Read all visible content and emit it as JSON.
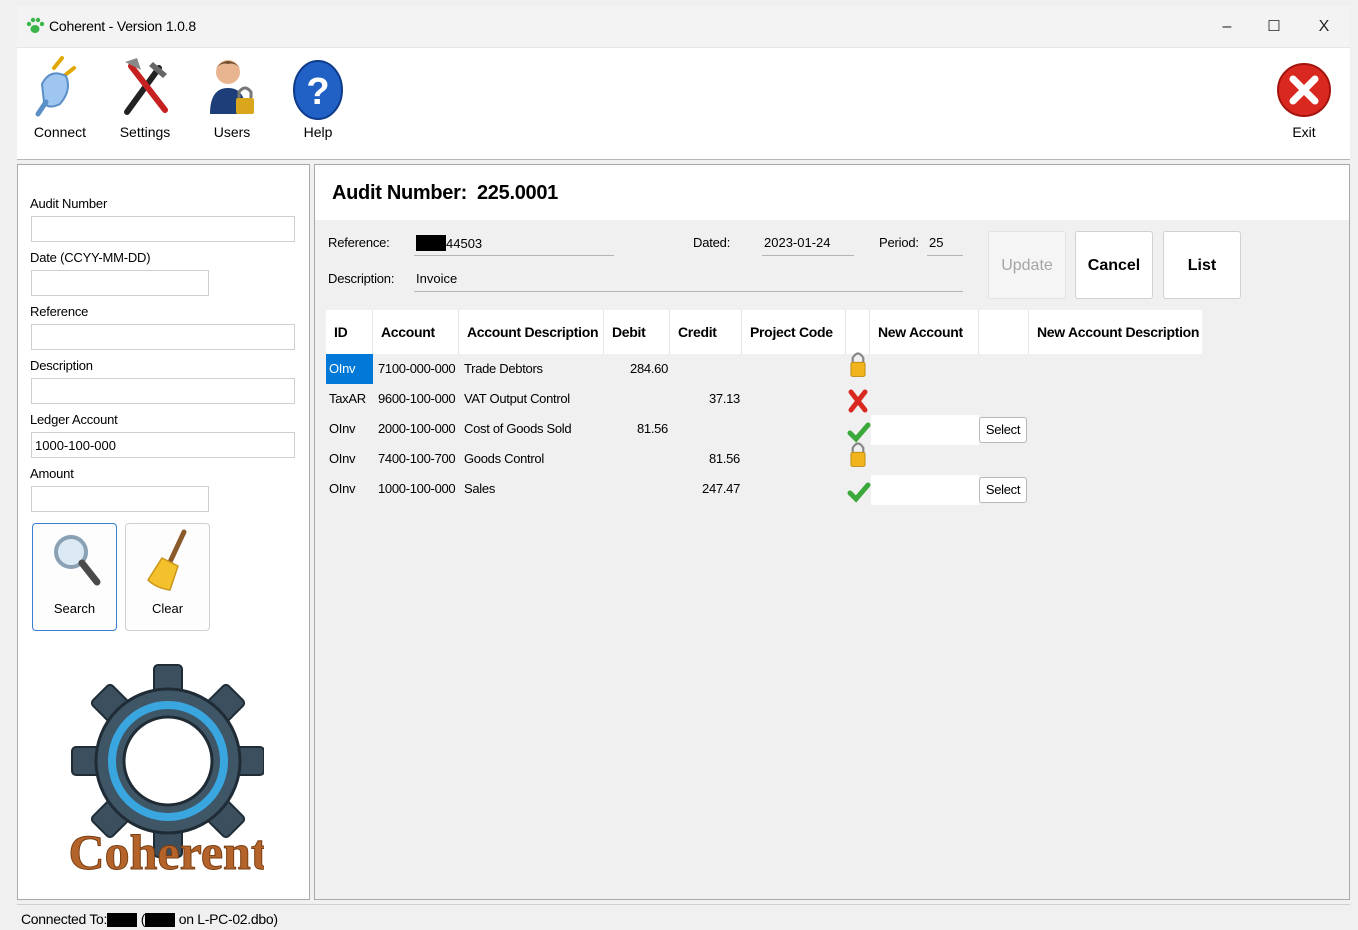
{
  "window": {
    "title": "Coherent - Version 1.0.8",
    "minimize": "–",
    "maximize": "☐",
    "close": "X"
  },
  "toolbar": {
    "items": [
      {
        "label": "Connect",
        "icon": "plug-icon"
      },
      {
        "label": "Settings",
        "icon": "tools-icon"
      },
      {
        "label": "Users",
        "icon": "user-lock-icon"
      },
      {
        "label": "Help",
        "icon": "help-icon"
      }
    ],
    "exit_label": "Exit"
  },
  "search_panel": {
    "audit_number_label": "Audit Number",
    "audit_number_value": "",
    "date_label": "Date (CCYY-MM-DD)",
    "date_value": "",
    "reference_label": "Reference",
    "reference_value": "",
    "description_label": "Description",
    "description_value": "",
    "ledger_account_label": "Ledger Account",
    "ledger_account_value": "1000-100-000",
    "amount_label": "Amount",
    "amount_value": "",
    "search_label": "Search",
    "clear_label": "Clear",
    "logo_text": "Coherent"
  },
  "audit": {
    "heading_label": "Audit Number:",
    "heading_value": "225.0001",
    "reference_label": "Reference:",
    "reference_value": "44503",
    "dated_label": "Dated:",
    "dated_value": "2023-01-24",
    "period_label": "Period:",
    "period_value": "25",
    "description_label": "Description:",
    "description_value": "Invoice",
    "update_label": "Update",
    "cancel_label": "Cancel",
    "list_label": "List"
  },
  "grid": {
    "headers": {
      "id": "ID",
      "account": "Account",
      "account_description": "Account Description",
      "debit": "Debit",
      "credit": "Credit",
      "project_code": "Project Code",
      "new_account": "New Account",
      "new_account_description": "New Account Description"
    },
    "select_label": "Select",
    "rows": [
      {
        "id": "OInv",
        "account": "7100-000-000",
        "description": "Trade Debtors",
        "debit": "284.60",
        "credit": "",
        "status": "lock-icon"
      },
      {
        "id": "TaxAR",
        "account": "9600-100-000",
        "description": "VAT Output Control",
        "debit": "",
        "credit": "37.13",
        "status": "red-x-icon"
      },
      {
        "id": "OInv",
        "account": "2000-100-000",
        "description": "Cost of Goods Sold",
        "debit": "81.56",
        "credit": "",
        "status": "green-check-icon"
      },
      {
        "id": "OInv",
        "account": "7400-100-700",
        "description": "Goods Control",
        "debit": "",
        "credit": "81.56",
        "status": "lock-icon"
      },
      {
        "id": "OInv",
        "account": "1000-100-000",
        "description": "Sales",
        "debit": "",
        "credit": "247.47",
        "status": "green-check-icon"
      }
    ]
  },
  "status_bar": {
    "prefix": "Connected To:",
    "middle": "(",
    "suffix": "on L-PC-02.dbo)"
  }
}
